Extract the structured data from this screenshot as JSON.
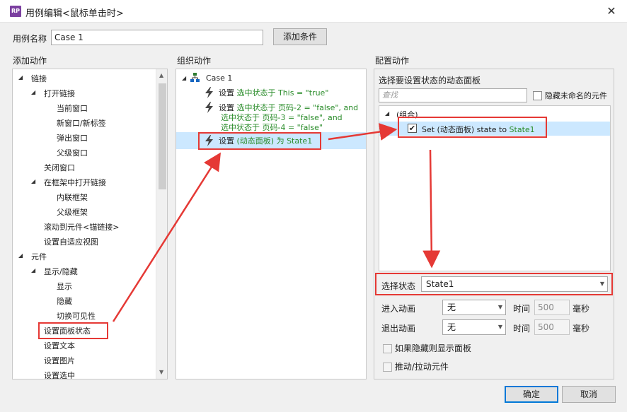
{
  "window": {
    "title": "用例编辑<鼠标单击时>",
    "app_icon": "RP",
    "close_glyph": "✕"
  },
  "case_name": {
    "label": "用例名称",
    "value": "Case 1",
    "add_condition": "添加条件"
  },
  "add_actions": {
    "heading": "添加动作",
    "items": [
      "链接",
      "打开链接",
      "当前窗口",
      "新窗口/新标签",
      "弹出窗口",
      "父级窗口",
      "关闭窗口",
      "在框架中打开链接",
      "内联框架",
      "父级框架",
      "滚动到元件<锚链接>",
      "设置自适应视图",
      "元件",
      "显示/隐藏",
      "显示",
      "隐藏",
      "切换可见性",
      "设置面板状态",
      "设置文本",
      "设置图片",
      "设置选中"
    ]
  },
  "organize_actions": {
    "heading": "组织动作",
    "case_label": "Case 1",
    "action1": {
      "prefix": "设置",
      "detail": "选中状态于 This = \"true\""
    },
    "action2": {
      "prefix": "设置",
      "line1": "选中状态于 页码-2 = \"false\", and",
      "line2": "选中状态于 页码-3 = \"false\", and",
      "line3": "选中状态于 页码-4 = \"false\""
    },
    "action3": {
      "prefix": "设置",
      "detail": "(动态面板) 为 State1"
    }
  },
  "configure_actions": {
    "heading": "配置动作",
    "panel_label": "选择要设置状态的动态面板",
    "search_placeholder": "查找",
    "hide_unnamed": "隐藏未命名的元件",
    "group_label": "(组合)",
    "item_prefix": "Set (动态面板) state to",
    "item_state": "State1",
    "select_state_label": "选择状态",
    "select_state_value": "State1",
    "enter_anim_label": "进入动画",
    "exit_anim_label": "退出动画",
    "anim_value": "无",
    "time_label": "时间",
    "time_value": "500",
    "ms_label": "毫秒",
    "show_if_hidden": "如果隐藏则显示面板",
    "push_pull": "推动/拉动元件"
  },
  "buttons": {
    "ok": "确定",
    "cancel": "取消"
  },
  "colors": {
    "accent_red": "#e53935",
    "action_green": "#2a8c2a",
    "selection_blue": "#cce8ff"
  }
}
